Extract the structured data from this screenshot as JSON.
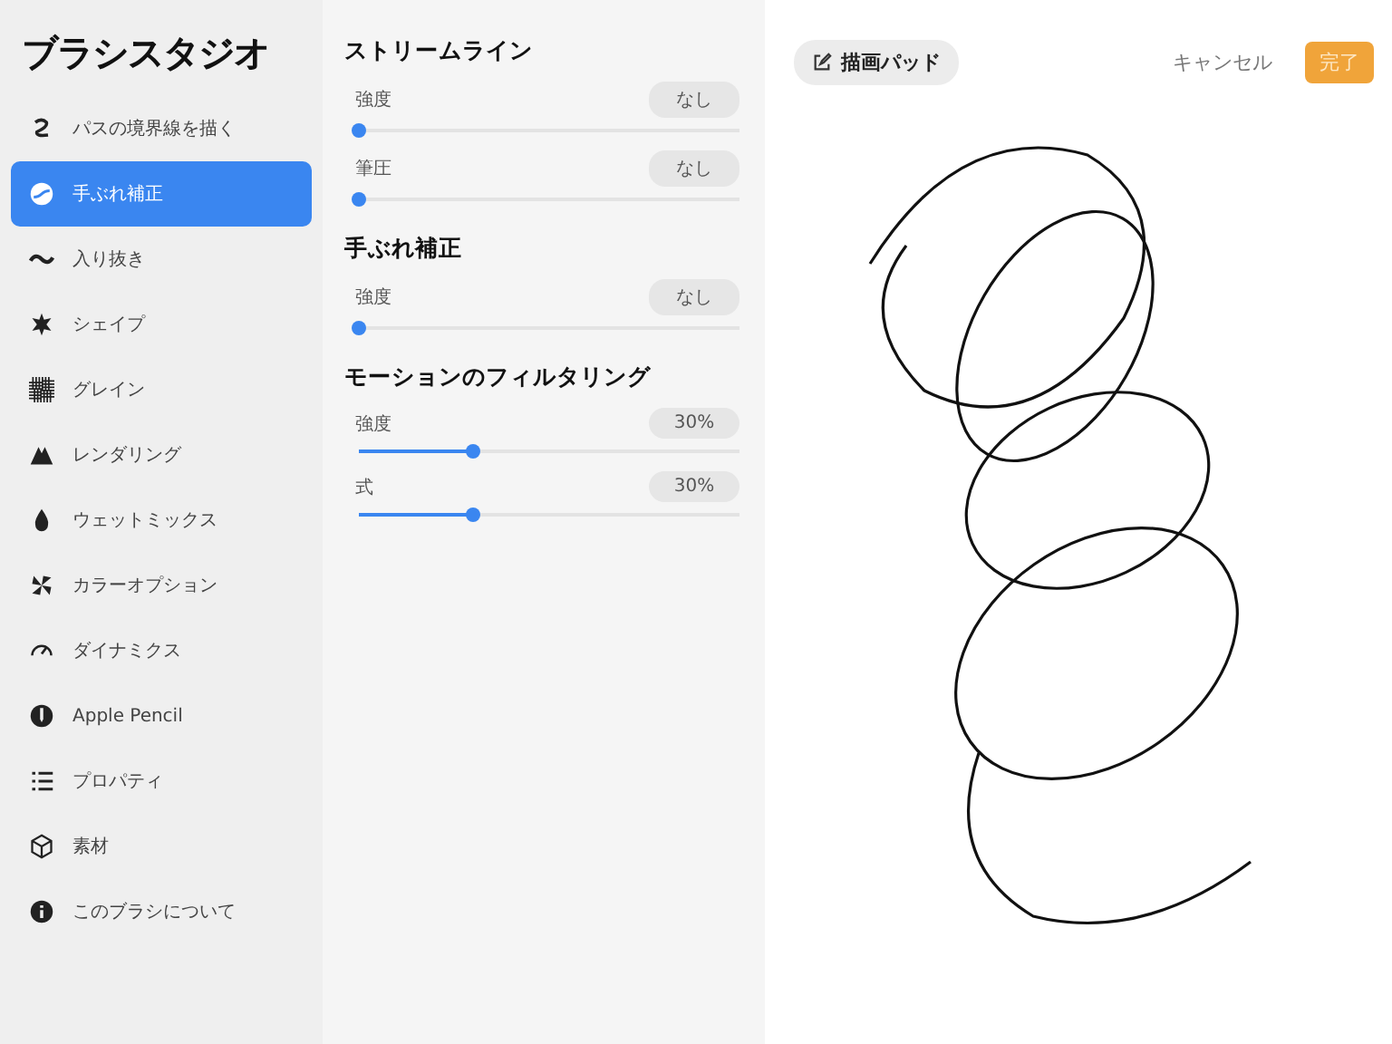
{
  "sidebar": {
    "title": "ブラシスタジオ",
    "items": [
      {
        "label": "パスの境界線を描く",
        "selected": false
      },
      {
        "label": "手ぶれ補正",
        "selected": true
      },
      {
        "label": "入り抜き",
        "selected": false
      },
      {
        "label": "シェイプ",
        "selected": false
      },
      {
        "label": "グレイン",
        "selected": false
      },
      {
        "label": "レンダリング",
        "selected": false
      },
      {
        "label": "ウェットミックス",
        "selected": false
      },
      {
        "label": "カラーオプション",
        "selected": false
      },
      {
        "label": "ダイナミクス",
        "selected": false
      },
      {
        "label": "Apple Pencil",
        "selected": false
      },
      {
        "label": "プロパティ",
        "selected": false
      },
      {
        "label": "素材",
        "selected": false
      },
      {
        "label": "このブラシについて",
        "selected": false
      }
    ]
  },
  "settings": [
    {
      "heading": "ストリームライン",
      "sliders": [
        {
          "label": "強度",
          "reading": "なし",
          "level": 0
        },
        {
          "label": "筆圧",
          "reading": "なし",
          "level": 0
        }
      ]
    },
    {
      "heading": "手ぶれ補正",
      "sliders": [
        {
          "label": "強度",
          "reading": "なし",
          "level": 0
        }
      ]
    },
    {
      "heading": "モーションのフィルタリング",
      "sliders": [
        {
          "label": "強度",
          "reading": "30%",
          "level": 0.3
        },
        {
          "label": "式",
          "reading": "30%",
          "level": 0.3
        }
      ]
    }
  ],
  "toolbar": {
    "pad_button": "描画パッド",
    "cancel": "キャンセル",
    "done": "完了"
  }
}
